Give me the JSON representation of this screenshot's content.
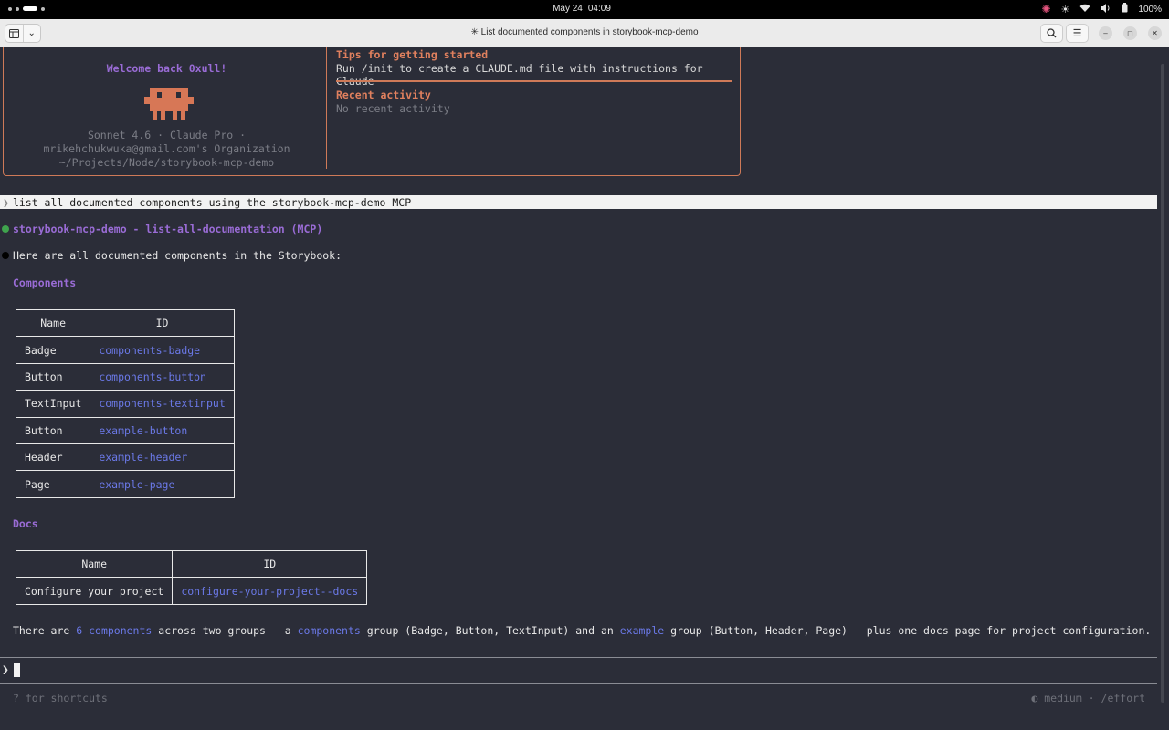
{
  "system_bar": {
    "date": "May 24",
    "time": "04:09",
    "battery": "100%"
  },
  "window": {
    "title": "✳ List documented components in storybook-mcp-demo"
  },
  "welcome_panel": {
    "greeting": "Welcome back 0xull!",
    "model_line": "Sonnet 4.6 · Claude Pro ·",
    "org_line": "mrikehchukwuka@gmail.com's Organization",
    "path_line": "~/Projects/Node/storybook-mcp-demo",
    "tips_heading": "Tips for getting started",
    "tips_text": "Run /init to create a CLAUDE.md file with instructions for Claude",
    "recent_heading": "Recent activity",
    "recent_text": "No recent activity",
    "accent_color": "#cf7a58"
  },
  "conversation": {
    "user_prompt": "list all documented components using the storybook-mcp-demo MCP",
    "tool_call": "storybook-mcp-demo - list-all-documentation (MCP)",
    "response_intro": "Here are all documented components in the Storybook:",
    "components_heading": "Components",
    "components_table": {
      "headers": [
        "Name",
        "ID"
      ],
      "rows": [
        {
          "name": "Badge",
          "id": "components-badge"
        },
        {
          "name": "Button",
          "id": "components-button"
        },
        {
          "name": "TextInput",
          "id": "components-textinput"
        },
        {
          "name": "Button",
          "id": "example-button"
        },
        {
          "name": "Header",
          "id": "example-header"
        },
        {
          "name": "Page",
          "id": "example-page"
        }
      ]
    },
    "docs_heading": "Docs",
    "docs_table": {
      "headers": [
        "Name",
        "ID"
      ],
      "rows": [
        {
          "name": "Configure your project",
          "id": "configure-your-project--docs"
        }
      ]
    },
    "summary": {
      "p1": "There are ",
      "hl1": "6 components",
      "p2": " across two groups — a ",
      "hl2": "components",
      "p3": " group (Badge, Button, TextInput) and an ",
      "hl3": "example",
      "p4": " group (Button, Header, Page) — plus one docs page for project configuration."
    }
  },
  "input": {
    "prompt_symbol": "❯",
    "footer_left": "? for shortcuts",
    "footer_right": "◐ medium · /effort"
  },
  "icons": [
    "grid-icon",
    "chevron-down-icon",
    "search-icon",
    "menu-icon",
    "minimize-icon",
    "maximize-icon",
    "close-icon",
    "wifi-icon",
    "volume-icon",
    "battery-icon",
    "brightness-icon"
  ]
}
